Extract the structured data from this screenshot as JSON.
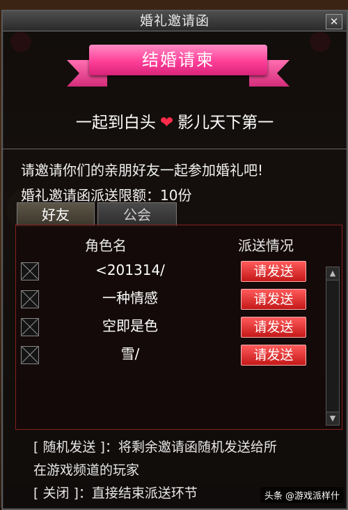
{
  "window": {
    "title": "婚礼邀请函",
    "close_label": "✕"
  },
  "card": {
    "ribbon_title": "结婚请柬",
    "partner_left": "一起到白头",
    "heart_symbol": "❤",
    "partner_right": "影儿天下第一"
  },
  "info": {
    "invite_text": "请邀请你们的亲朋好友一起参加婚礼吧!",
    "quota_text": "婚礼邀请函派送限额：10份"
  },
  "tabs": [
    {
      "label": "好友",
      "selected": true
    },
    {
      "label": "公会",
      "selected": false
    }
  ],
  "table": {
    "headers": {
      "name": "角色名",
      "status": "派送情况"
    },
    "rows": [
      {
        "name": "<201314/",
        "action": "请发送"
      },
      {
        "name": "一种情感",
        "action": "请发送"
      },
      {
        "name": "空即是色",
        "action": "请发送"
      },
      {
        "name": "雪/",
        "action": "请发送"
      }
    ]
  },
  "footer": {
    "random_line1": "[ 随机发送 ]：将剩余邀请函随机发送给所",
    "random_line2": "在游戏频道的玩家",
    "close_line": "[ 关闭 ]：直接结束派送环节"
  },
  "watermark": "头条 @游戏派样什",
  "colors": {
    "ribbon": "#ff3f98",
    "send_button": "#c41818",
    "heart": "#ff2b4a"
  }
}
